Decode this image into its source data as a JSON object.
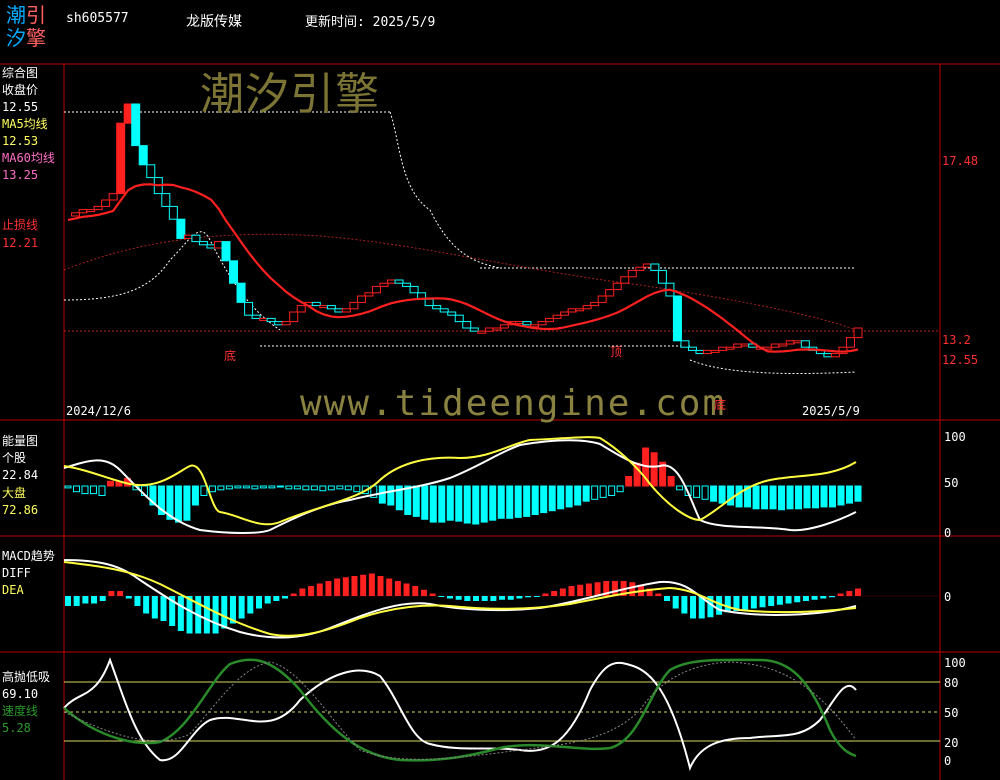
{
  "header": {
    "logo": [
      "潮",
      "引",
      "汐",
      "擎"
    ],
    "code": "sh605577",
    "name": "龙版传媒",
    "update": "更新时间: 2025/5/9"
  },
  "main_panel": {
    "title": "综合图",
    "close_label": "收盘价",
    "close_value": "12.55",
    "ma5_label": "MA5均线",
    "ma5_value": "12.53",
    "ma60_label": "MA60均线",
    "ma60_value": "13.25",
    "stop_label": "止损线",
    "stop_value": "12.21",
    "date_start": "2024/12/6",
    "date_end": "2025/5/9",
    "right_levels": [
      "17.48",
      "13.2",
      "12.55"
    ],
    "markers": [
      "底",
      "顶",
      "底"
    ],
    "watermark_top": "潮汐引擎",
    "watermark_url": "www.tideengine.com"
  },
  "energy_panel": {
    "title": "能量图",
    "stock_label": "个股",
    "stock_value": "22.84",
    "market_label": "大盘",
    "market_value": "72.86",
    "ticks": [
      "100",
      "50",
      "0"
    ]
  },
  "macd_panel": {
    "title": "MACD趋势",
    "diff_label": "DIFF",
    "dea_label": "DEA",
    "ticks": [
      "0"
    ]
  },
  "tide_panel": {
    "title": "高抛低吸",
    "value": "69.10",
    "speed_label": "速度线",
    "speed_value": "5.28",
    "ticks": [
      "100",
      "80",
      "50",
      "20",
      "0"
    ]
  },
  "colors": {
    "up": "#ff2020",
    "down": "#00ffff",
    "ma5": "#ffffff",
    "ma60": "#ff2020",
    "diff": "#ffffff",
    "dea": "#ffff40",
    "speed": "#2a8a2a",
    "border": "#c00000"
  },
  "chart_data": [
    {
      "type": "candlestick",
      "title": "",
      "x_range": [
        "2024/12/6",
        "2025/5/9"
      ],
      "close_path": [
        11.3,
        11.4,
        11.5,
        11.5,
        11.6,
        11.8,
        12.0,
        14.2,
        14.8,
        13.5,
        12.9,
        12.5,
        12.0,
        11.6,
        11.2,
        10.6,
        10.7,
        10.5,
        10.4,
        10.3,
        10.5,
        9.9,
        9.2,
        8.6,
        8.2,
        8.1,
        8.1,
        8.0,
        7.9,
        8.0,
        8.3,
        8.5,
        8.6,
        8.5,
        8.5,
        8.4,
        8.3,
        8.4,
        8.6,
        8.8,
        8.9,
        9.1,
        9.2,
        9.3,
        9.2,
        9.1,
        8.9,
        8.7,
        8.5,
        8.4,
        8.3,
        8.2,
        8.0,
        7.8,
        7.7,
        7.7,
        7.8,
        7.8,
        7.9,
        8.0,
        8.0,
        7.9,
        7.9,
        8.0,
        8.1,
        8.2,
        8.3,
        8.4,
        8.4,
        8.5,
        8.6,
        8.8,
        9.0,
        9.2,
        9.4,
        9.6,
        9.7,
        9.8,
        9.6,
        9.2,
        8.8,
        7.4,
        7.2,
        7.1,
        7.0,
        7.1,
        7.1,
        7.2,
        7.2,
        7.3,
        7.3,
        7.2,
        7.2,
        7.2,
        7.3,
        7.3,
        7.4,
        7.4,
        7.2,
        7.1,
        7.0,
        6.9,
        7.0,
        7.2,
        7.5,
        7.8
      ],
      "ma60_values": [
        "13.25"
      ],
      "labels": [
        "17.48",
        "13.2",
        "12.55"
      ]
    },
    {
      "type": "bar",
      "title": "",
      "stock": 22.84,
      "market": 72.86,
      "ylim": [
        0,
        100
      ],
      "bars": [
        -2,
        -6,
        -8,
        -8,
        -10,
        5,
        5,
        8,
        -4,
        -10,
        -20,
        -30,
        -35,
        -38,
        -36,
        -20,
        -10,
        -6,
        -4,
        -3,
        -2,
        -2,
        -3,
        -2,
        -2,
        -1,
        -3,
        -3,
        -4,
        -4,
        -5,
        -4,
        -3,
        -4,
        -6,
        -8,
        -12,
        -18,
        -20,
        -25,
        -30,
        -32,
        -35,
        -38,
        -38,
        -36,
        -37,
        -39,
        -40,
        -38,
        -36,
        -34,
        -34,
        -33,
        -32,
        -30,
        -28,
        -26,
        -24,
        -22,
        -20,
        -16,
        -14,
        -12,
        -10,
        -6,
        10,
        24,
        40,
        35,
        25,
        10,
        -4,
        -10,
        -12,
        -14,
        -16,
        -18,
        -20,
        -22,
        -22,
        -24,
        -24,
        -24,
        -25,
        -24,
        -24,
        -23,
        -23,
        -22,
        -22,
        -20,
        -18,
        -16
      ]
    },
    {
      "type": "bar",
      "title": "",
      "series": [
        {
          "name": "DIFF"
        },
        {
          "name": "DEA"
        }
      ],
      "macd": [
        -8,
        -8,
        -6,
        -6,
        -4,
        4,
        4,
        -2,
        -8,
        -14,
        -18,
        -20,
        -24,
        -28,
        -30,
        -30,
        -30,
        -30,
        -26,
        -22,
        -18,
        -14,
        -10,
        -6,
        -4,
        -2,
        2,
        6,
        8,
        10,
        12,
        14,
        15,
        16,
        17,
        18,
        16,
        14,
        12,
        10,
        8,
        5,
        2,
        0,
        -2,
        -3,
        -4,
        -4,
        -4,
        -4,
        -3,
        -3,
        -2,
        -1,
        0,
        2,
        4,
        6,
        8,
        9,
        10,
        11,
        12,
        12,
        12,
        11,
        9,
        6,
        2,
        -4,
        -10,
        -14,
        -18,
        -18,
        -17,
        -15,
        -13,
        -12,
        -11,
        -10,
        -9,
        -8,
        -7,
        -6,
        -5,
        -4,
        -3,
        -2,
        -1,
        2,
        4,
        6
      ]
    },
    {
      "type": "line",
      "title": "",
      "series": [
        {
          "name": "速度线"
        }
      ],
      "ylim": [
        0,
        100
      ],
      "value": 69.1,
      "speed": 5.28,
      "ticks": [
        100,
        80,
        50,
        20,
        0
      ]
    }
  ]
}
